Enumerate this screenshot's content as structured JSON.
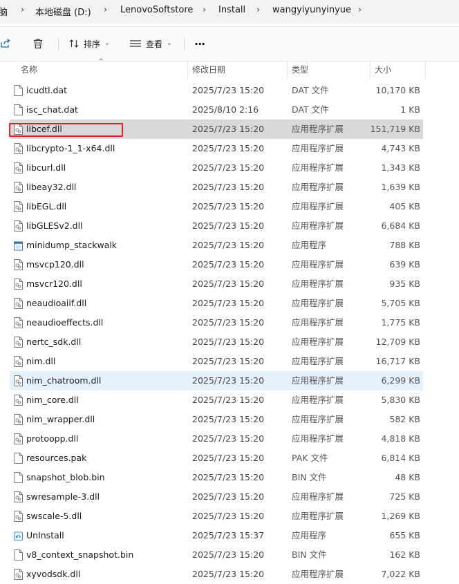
{
  "breadcrumb": {
    "items": [
      "脑",
      "本地磁盘 (D:)",
      "LenovoSoftstore",
      "Install",
      "wangyiyunyinyue"
    ]
  },
  "toolbar": {
    "sort_label": "排序",
    "view_label": "查看",
    "more_label": "···"
  },
  "columns": {
    "name": "名称",
    "date": "修改日期",
    "type": "类型",
    "size": "大小"
  },
  "files": [
    {
      "name": "icudtl.dat",
      "date": "2025/7/23 15:20",
      "type": "DAT 文件",
      "size": "10,170 KB",
      "icon": "file-icon"
    },
    {
      "name": "isc_chat.dat",
      "date": "2025/8/10 2:16",
      "type": "DAT 文件",
      "size": "1 KB",
      "icon": "file-icon"
    },
    {
      "name": "libcef.dll",
      "date": "2025/7/23 15:20",
      "type": "应用程序扩展",
      "size": "151,719 KB",
      "icon": "dll-icon"
    },
    {
      "name": "libcrypto-1_1-x64.dll",
      "date": "2025/7/23 15:20",
      "type": "应用程序扩展",
      "size": "4,743 KB",
      "icon": "dll-icon"
    },
    {
      "name": "libcurl.dll",
      "date": "2025/7/23 15:20",
      "type": "应用程序扩展",
      "size": "1,343 KB",
      "icon": "dll-icon"
    },
    {
      "name": "libeay32.dll",
      "date": "2025/7/23 15:20",
      "type": "应用程序扩展",
      "size": "1,639 KB",
      "icon": "dll-icon"
    },
    {
      "name": "libEGL.dll",
      "date": "2025/7/23 15:20",
      "type": "应用程序扩展",
      "size": "405 KB",
      "icon": "dll-icon"
    },
    {
      "name": "libGLESv2.dll",
      "date": "2025/7/23 15:20",
      "type": "应用程序扩展",
      "size": "6,684 KB",
      "icon": "dll-icon"
    },
    {
      "name": "minidump_stackwalk",
      "date": "2025/7/23 15:20",
      "type": "应用程序",
      "size": "788 KB",
      "icon": "exe-icon"
    },
    {
      "name": "msvcp120.dll",
      "date": "2025/7/23 15:20",
      "type": "应用程序扩展",
      "size": "639 KB",
      "icon": "dll-icon"
    },
    {
      "name": "msvcr120.dll",
      "date": "2025/7/23 15:20",
      "type": "应用程序扩展",
      "size": "935 KB",
      "icon": "dll-icon"
    },
    {
      "name": "neaudioaiif.dll",
      "date": "2025/7/23 15:20",
      "type": "应用程序扩展",
      "size": "5,705 KB",
      "icon": "dll-icon"
    },
    {
      "name": "neaudioeffects.dll",
      "date": "2025/7/23 15:20",
      "type": "应用程序扩展",
      "size": "1,775 KB",
      "icon": "dll-icon"
    },
    {
      "name": "nertc_sdk.dll",
      "date": "2025/7/23 15:20",
      "type": "应用程序扩展",
      "size": "12,709 KB",
      "icon": "dll-icon"
    },
    {
      "name": "nim.dll",
      "date": "2025/7/23 15:20",
      "type": "应用程序扩展",
      "size": "16,717 KB",
      "icon": "dll-icon"
    },
    {
      "name": "nim_chatroom.dll",
      "date": "2025/7/23 15:20",
      "type": "应用程序扩展",
      "size": "6,299 KB",
      "icon": "dll-icon"
    },
    {
      "name": "nim_core.dll",
      "date": "2025/7/23 15:20",
      "type": "应用程序扩展",
      "size": "5,830 KB",
      "icon": "dll-icon"
    },
    {
      "name": "nim_wrapper.dll",
      "date": "2025/7/23 15:20",
      "type": "应用程序扩展",
      "size": "582 KB",
      "icon": "dll-icon"
    },
    {
      "name": "protoopp.dll",
      "date": "2025/7/23 15:20",
      "type": "应用程序扩展",
      "size": "4,818 KB",
      "icon": "dll-icon"
    },
    {
      "name": "resources.pak",
      "date": "2025/7/23 15:20",
      "type": "PAK 文件",
      "size": "6,814 KB",
      "icon": "file-icon"
    },
    {
      "name": "snapshot_blob.bin",
      "date": "2025/7/23 15:20",
      "type": "BIN 文件",
      "size": "48 KB",
      "icon": "file-icon"
    },
    {
      "name": "swresample-3.dll",
      "date": "2025/7/23 15:20",
      "type": "应用程序扩展",
      "size": "725 KB",
      "icon": "dll-icon"
    },
    {
      "name": "swscale-5.dll",
      "date": "2025/7/23 15:20",
      "type": "应用程序扩展",
      "size": "1,269 KB",
      "icon": "dll-icon"
    },
    {
      "name": "UnInstall",
      "date": "2025/7/23 15:37",
      "type": "应用程序",
      "size": "655 KB",
      "icon": "uninstall-icon"
    },
    {
      "name": "v8_context_snapshot.bin",
      "date": "2025/7/23 15:20",
      "type": "BIN 文件",
      "size": "162 KB",
      "icon": "file-icon"
    },
    {
      "name": "xyvodsdk.dll",
      "date": "2025/7/23 15:20",
      "type": "应用程序扩展",
      "size": "7,022 KB",
      "icon": "dll-icon"
    }
  ],
  "state": {
    "selected": "libcef.dll",
    "hovered": "nim_chatroom.dll"
  },
  "colors": {
    "selection": "#d9d9d9",
    "hover": "#e5f1fb",
    "highlight_box": "#e0252a"
  }
}
